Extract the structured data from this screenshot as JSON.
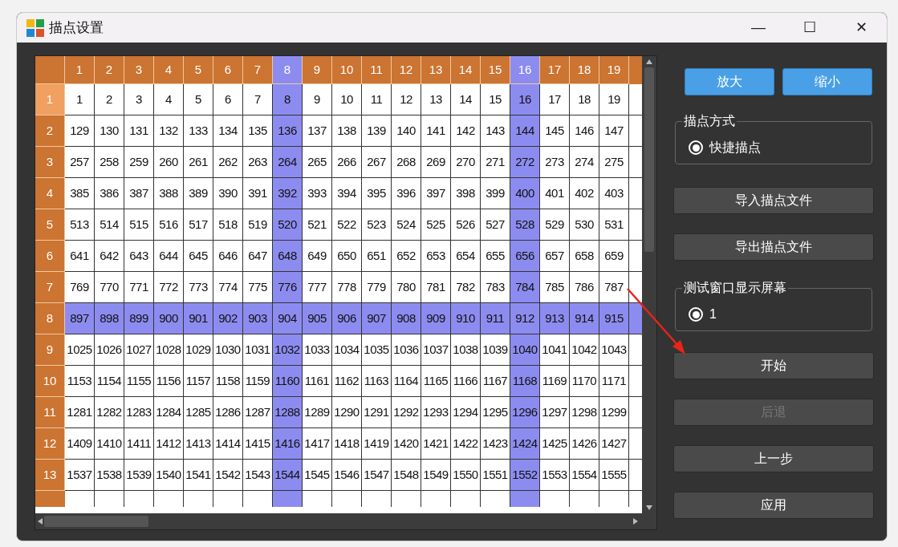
{
  "window": {
    "title": "描点设置",
    "controls": [
      "—",
      "☐",
      "✕"
    ]
  },
  "grid": {
    "columns": [
      {
        "label": "1",
        "selected": false
      },
      {
        "label": "2",
        "selected": false
      },
      {
        "label": "3",
        "selected": false
      },
      {
        "label": "4",
        "selected": false
      },
      {
        "label": "5",
        "selected": false
      },
      {
        "label": "6",
        "selected": false
      },
      {
        "label": "7",
        "selected": false
      },
      {
        "label": "8",
        "selected": true
      },
      {
        "label": "9",
        "selected": false
      },
      {
        "label": "10",
        "selected": false
      },
      {
        "label": "11",
        "selected": false
      },
      {
        "label": "12",
        "selected": false
      },
      {
        "label": "13",
        "selected": false
      },
      {
        "label": "14",
        "selected": false
      },
      {
        "label": "15",
        "selected": false
      },
      {
        "label": "16",
        "selected": true
      },
      {
        "label": "17",
        "selected": false
      },
      {
        "label": "18",
        "selected": false
      },
      {
        "label": "19",
        "selected": false
      }
    ],
    "rows": [
      {
        "label": "1",
        "selected": false,
        "current": true,
        "cells": [
          "1",
          "2",
          "3",
          "4",
          "5",
          "6",
          "7",
          "8",
          "9",
          "10",
          "11",
          "12",
          "13",
          "14",
          "15",
          "16",
          "17",
          "18",
          "19"
        ]
      },
      {
        "label": "2",
        "selected": false,
        "current": false,
        "cells": [
          "129",
          "130",
          "131",
          "132",
          "133",
          "134",
          "135",
          "136",
          "137",
          "138",
          "139",
          "140",
          "141",
          "142",
          "143",
          "144",
          "145",
          "146",
          "147"
        ]
      },
      {
        "label": "3",
        "selected": false,
        "current": false,
        "cells": [
          "257",
          "258",
          "259",
          "260",
          "261",
          "262",
          "263",
          "264",
          "265",
          "266",
          "267",
          "268",
          "269",
          "270",
          "271",
          "272",
          "273",
          "274",
          "275"
        ]
      },
      {
        "label": "4",
        "selected": false,
        "current": false,
        "cells": [
          "385",
          "386",
          "387",
          "388",
          "389",
          "390",
          "391",
          "392",
          "393",
          "394",
          "395",
          "396",
          "397",
          "398",
          "399",
          "400",
          "401",
          "402",
          "403"
        ]
      },
      {
        "label": "5",
        "selected": false,
        "current": false,
        "cells": [
          "513",
          "514",
          "515",
          "516",
          "517",
          "518",
          "519",
          "520",
          "521",
          "522",
          "523",
          "524",
          "525",
          "526",
          "527",
          "528",
          "529",
          "530",
          "531"
        ]
      },
      {
        "label": "6",
        "selected": false,
        "current": false,
        "cells": [
          "641",
          "642",
          "643",
          "644",
          "645",
          "646",
          "647",
          "648",
          "649",
          "650",
          "651",
          "652",
          "653",
          "654",
          "655",
          "656",
          "657",
          "658",
          "659"
        ]
      },
      {
        "label": "7",
        "selected": false,
        "current": false,
        "cells": [
          "769",
          "770",
          "771",
          "772",
          "773",
          "774",
          "775",
          "776",
          "777",
          "778",
          "779",
          "780",
          "781",
          "782",
          "783",
          "784",
          "785",
          "786",
          "787"
        ]
      },
      {
        "label": "8",
        "selected": true,
        "current": false,
        "cells": [
          "897",
          "898",
          "899",
          "900",
          "901",
          "902",
          "903",
          "904",
          "905",
          "906",
          "907",
          "908",
          "909",
          "910",
          "911",
          "912",
          "913",
          "914",
          "915"
        ]
      },
      {
        "label": "9",
        "selected": false,
        "current": false,
        "cells": [
          "1025",
          "1026",
          "1027",
          "1028",
          "1029",
          "1030",
          "1031",
          "1032",
          "1033",
          "1034",
          "1035",
          "1036",
          "1037",
          "1038",
          "1039",
          "1040",
          "1041",
          "1042",
          "1043"
        ]
      },
      {
        "label": "10",
        "selected": false,
        "current": false,
        "cells": [
          "1153",
          "1154",
          "1155",
          "1156",
          "1157",
          "1158",
          "1159",
          "1160",
          "1161",
          "1162",
          "1163",
          "1164",
          "1165",
          "1166",
          "1167",
          "1168",
          "1169",
          "1170",
          "1171"
        ]
      },
      {
        "label": "11",
        "selected": false,
        "current": false,
        "cells": [
          "1281",
          "1282",
          "1283",
          "1284",
          "1285",
          "1286",
          "1287",
          "1288",
          "1289",
          "1290",
          "1291",
          "1292",
          "1293",
          "1294",
          "1295",
          "1296",
          "1297",
          "1298",
          "1299"
        ]
      },
      {
        "label": "12",
        "selected": false,
        "current": false,
        "cells": [
          "1409",
          "1410",
          "1411",
          "1412",
          "1413",
          "1414",
          "1415",
          "1416",
          "1417",
          "1418",
          "1419",
          "1420",
          "1421",
          "1422",
          "1423",
          "1424",
          "1425",
          "1426",
          "1427"
        ]
      },
      {
        "label": "13",
        "selected": false,
        "current": false,
        "cells": [
          "1537",
          "1538",
          "1539",
          "1540",
          "1541",
          "1542",
          "1543",
          "1544",
          "1545",
          "1546",
          "1547",
          "1548",
          "1549",
          "1550",
          "1551",
          "1552",
          "1553",
          "1554",
          "1555"
        ]
      }
    ]
  },
  "zoom_buttons": [
    "放大",
    "缩小"
  ],
  "mode_group": {
    "title": "描点方式",
    "options": [
      {
        "label": "快捷描点",
        "selected": true
      }
    ]
  },
  "file_buttons": [
    "导入描点文件",
    "导出描点文件"
  ],
  "screen_group": {
    "title": "测试窗口显示屏幕",
    "options": [
      {
        "label": "1",
        "selected": true
      }
    ]
  },
  "action_buttons": [
    {
      "label": "开始",
      "disabled": false
    },
    {
      "label": "后退",
      "disabled": true
    },
    {
      "label": "上一步",
      "disabled": false
    },
    {
      "label": "应用",
      "disabled": false
    }
  ]
}
